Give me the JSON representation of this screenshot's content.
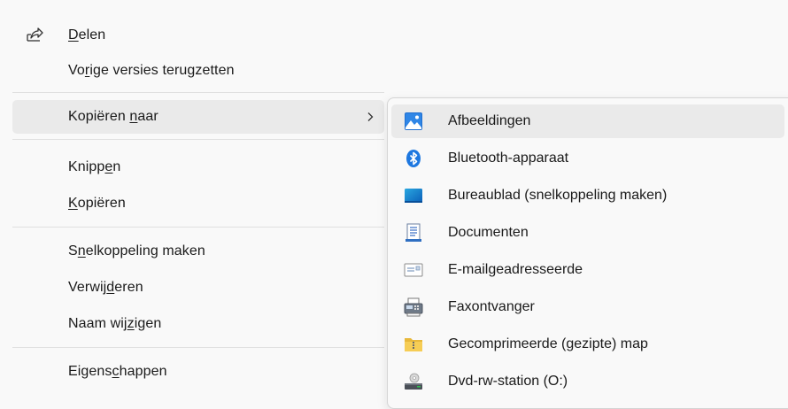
{
  "main_menu": {
    "items": [
      {
        "label_pre": "",
        "label_acc": "D",
        "label_post": "elen",
        "icon": "share-icon"
      },
      {
        "label_pre": "Vo",
        "label_acc": "r",
        "label_post": "ige versies terugzetten"
      },
      {
        "label_pre": "Kopiëren ",
        "label_acc": "n",
        "label_post": "aar",
        "submenu_indicator": "chevron-right-icon"
      },
      {
        "label_pre": "Knipp",
        "label_acc": "e",
        "label_post": "n"
      },
      {
        "label_pre": "",
        "label_acc": "K",
        "label_post": "opiëren"
      },
      {
        "label_pre": "S",
        "label_acc": "n",
        "label_post": "elkoppeling maken"
      },
      {
        "label_pre": "Verwij",
        "label_acc": "d",
        "label_post": "eren"
      },
      {
        "label_pre": "Naam wij",
        "label_acc": "z",
        "label_post": "igen"
      },
      {
        "label_pre": "Eigens",
        "label_acc": "c",
        "label_post": "happen"
      }
    ]
  },
  "submenu": {
    "items": [
      {
        "label": "Afbeeldingen",
        "icon": "pictures-icon"
      },
      {
        "label": "Bluetooth-apparaat",
        "icon": "bluetooth-icon"
      },
      {
        "label": "Bureaublad (snelkoppeling maken)",
        "icon": "desktop-icon"
      },
      {
        "label": "Documenten",
        "icon": "documents-icon"
      },
      {
        "label": "E-mailgeadresseerde",
        "icon": "mail-recipient-icon"
      },
      {
        "label": "Faxontvanger",
        "icon": "fax-icon"
      },
      {
        "label": "Gecomprimeerde (gezipte) map",
        "icon": "zip-folder-icon"
      },
      {
        "label": "Dvd-rw-station (O:)",
        "icon": "dvd-drive-icon"
      }
    ]
  },
  "colors": {
    "background": "#f9f9f9",
    "highlight": "#eaeaea",
    "separator": "#e0e0e0",
    "accent_blue": "#0067c0"
  }
}
